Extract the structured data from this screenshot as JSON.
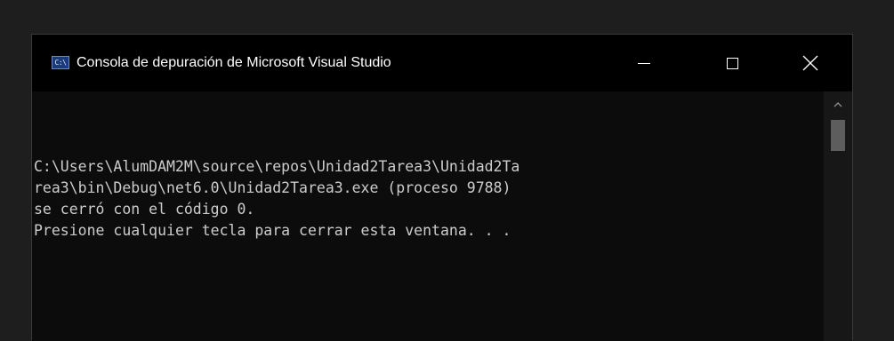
{
  "window": {
    "title": "Consola de depuración de Microsoft Visual Studio",
    "icon": "console-app-icon",
    "icon_text": "C:\\"
  },
  "controls": {
    "minimize_icon": "minimize-icon",
    "maximize_icon": "maximize-icon",
    "close_icon": "close-icon"
  },
  "console": {
    "lines": [
      "C:\\Users\\AlumDAM2M\\source\\repos\\Unidad2Tarea3\\Unidad2Ta",
      "rea3\\bin\\Debug\\net6.0\\Unidad2Tarea3.exe (proceso 9788)",
      "se cerró con el código 0.",
      "Presione cualquier tecla para cerrar esta ventana. . ."
    ],
    "text_color": "#cccccc",
    "background_color": "#0c0c0c"
  },
  "scrollbar": {
    "up_icon": "chevron-up-icon"
  }
}
